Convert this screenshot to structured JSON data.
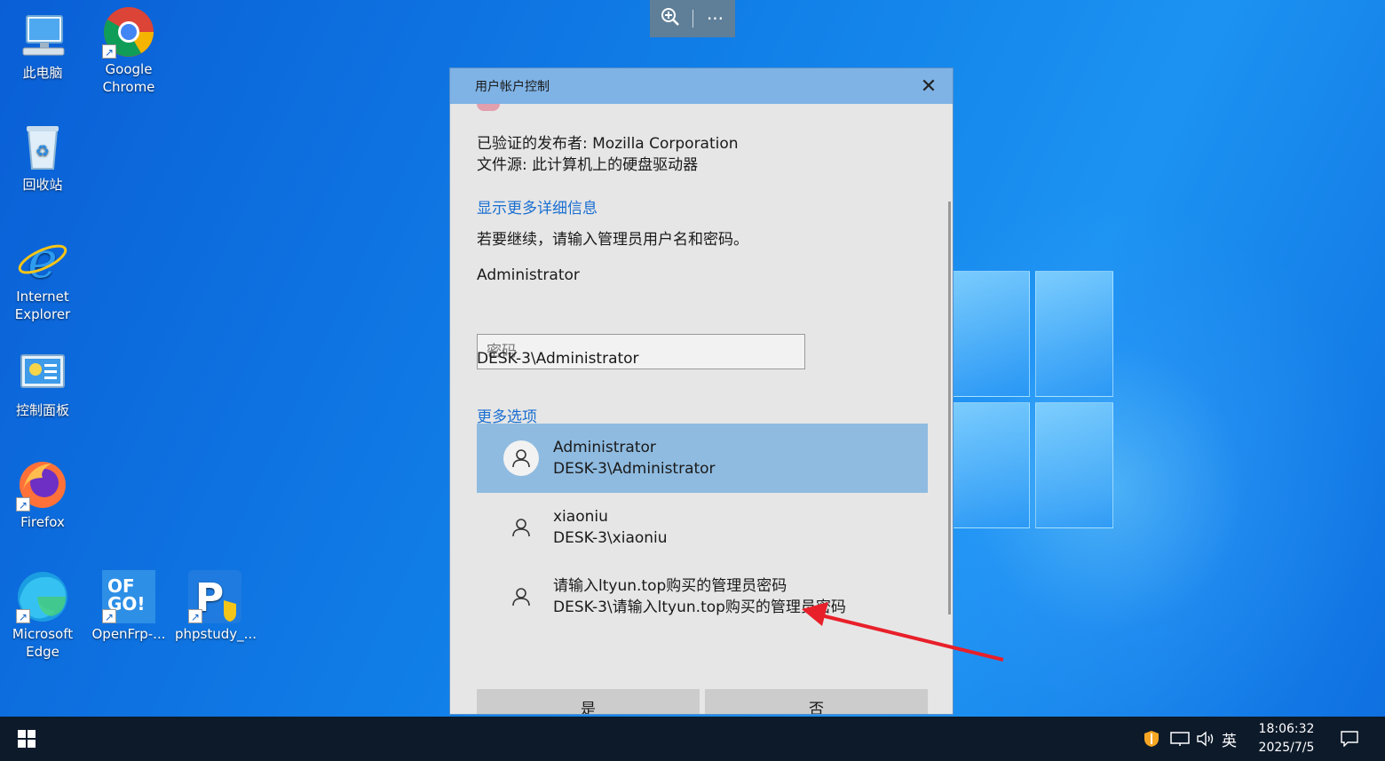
{
  "desktop": {
    "icons": [
      {
        "label": "此电脑"
      },
      {
        "label": "Google Chrome"
      },
      {
        "label": "回收站"
      },
      {
        "label": "Internet Explorer"
      },
      {
        "label": "控制面板"
      },
      {
        "label": "Firefox"
      },
      {
        "label": "Microsoft Edge"
      },
      {
        "label": "OpenFrp-..."
      },
      {
        "label": "phpstudy_..."
      }
    ],
    "ofgo_text": "OF GO!"
  },
  "toolbar": {
    "zoom_icon": "zoom-in-icon",
    "more_label": "···"
  },
  "dialog": {
    "title": "用户帐户控制",
    "close_label": "✕",
    "publisher": "已验证的发布者: Mozilla Corporation",
    "source": "文件源: 此计算机上的硬盘驱动器",
    "show_details": "显示更多详细信息",
    "instruction": "若要继续，请输入管理员用户名和密码。",
    "username": "Administrator",
    "password_placeholder": "密码",
    "domain_user": "DESK-3\\Administrator",
    "more_options": "更多选项",
    "accounts": [
      {
        "name": "Administrator",
        "domain": "DESK-3\\Administrator",
        "selected": true
      },
      {
        "name": "xiaoniu",
        "domain": "DESK-3\\xiaoniu",
        "selected": false
      },
      {
        "name": "请输入ltyun.top购买的管理员密码",
        "domain": "DESK-3\\请输入ltyun.top购买的管理员密码",
        "selected": false
      }
    ],
    "yes_label": "是",
    "no_label": "否"
  },
  "taskbar": {
    "ime": "英",
    "time": "18:06:32",
    "date": "2025/7/5"
  },
  "colors": {
    "accent": "#7fb3e5",
    "selected_row": "#8fbbe0",
    "link": "#1a6fd1",
    "arrow": "#e8202a"
  }
}
